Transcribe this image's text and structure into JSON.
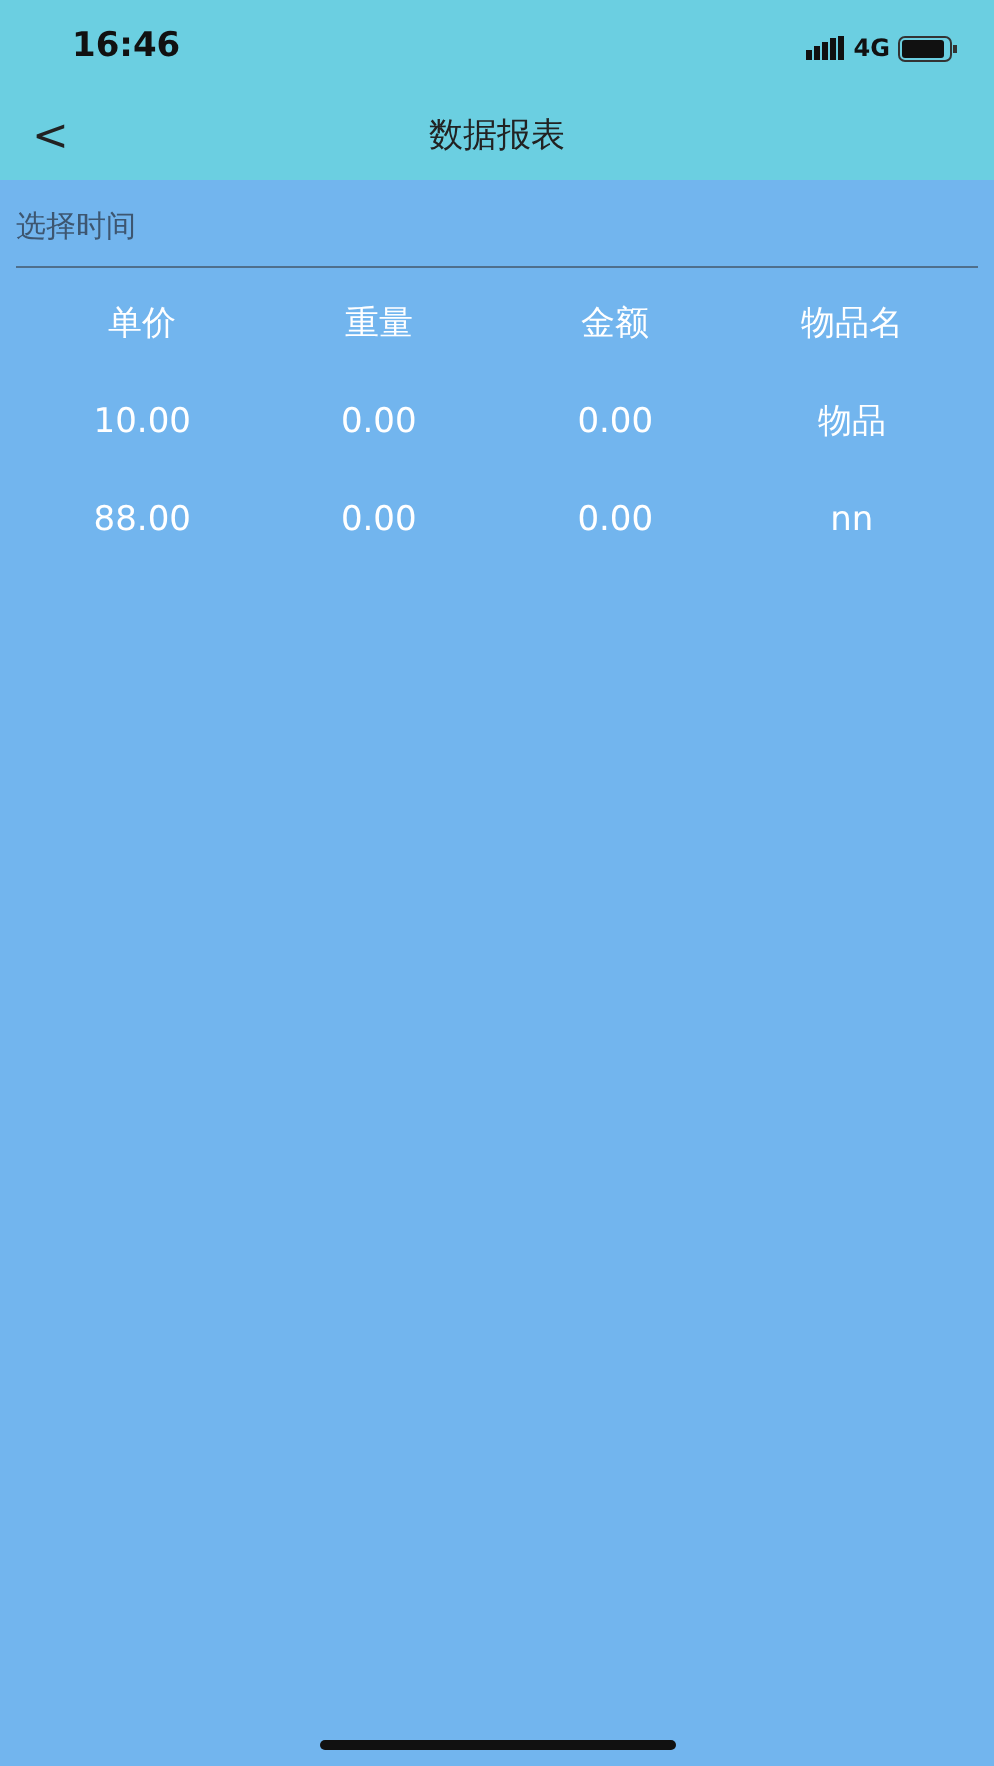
{
  "status_bar": {
    "time": "16:46",
    "network": "4G"
  },
  "nav": {
    "back": "<",
    "title": "数据报表"
  },
  "filter": {
    "placeholder": "选择时间"
  },
  "table": {
    "columns": [
      "单价",
      "重量",
      "金额",
      "物品名"
    ],
    "rows": [
      [
        "10.00",
        "0.00",
        "0.00",
        "物品"
      ],
      [
        "88.00",
        "0.00",
        "0.00",
        "nn"
      ]
    ]
  }
}
